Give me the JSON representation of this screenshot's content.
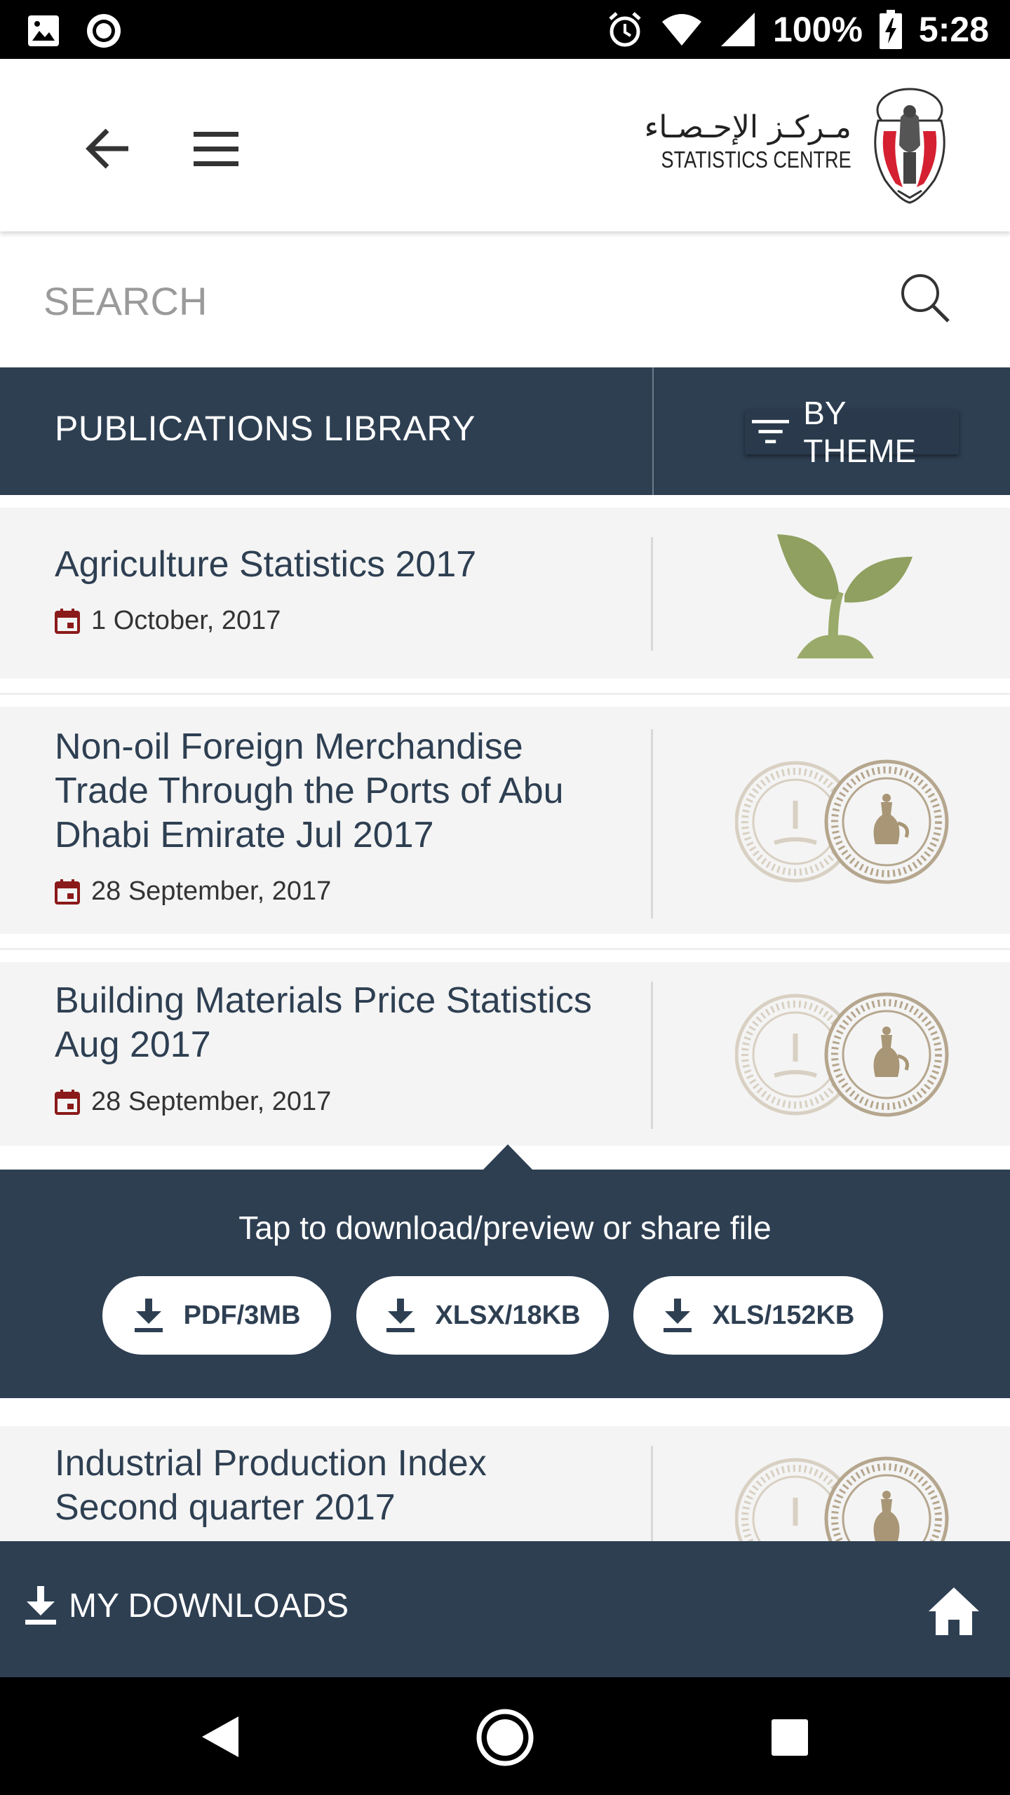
{
  "status_bar": {
    "battery": "100%",
    "time": "5:28",
    "icons": [
      "image-icon",
      "record-icon",
      "alarm-icon",
      "wifi-icon",
      "signal-icon",
      "battery-charging-icon"
    ]
  },
  "header": {
    "logo_arabic": "مـركـز الإحـصـاء",
    "logo_english": "STATISTICS CENTRE",
    "back_icon": "arrow-left-icon",
    "menu_icon": "hamburger-icon"
  },
  "search": {
    "placeholder": "SEARCH",
    "value": ""
  },
  "library": {
    "title": "PUBLICATIONS LIBRARY",
    "filter_label": "BY THEME"
  },
  "publications": [
    {
      "title": "Agriculture Statistics 2017",
      "date": "1 October, 2017",
      "icon": "plant-icon"
    },
    {
      "title": "Non-oil Foreign Merchandise Trade Through the Ports of Abu Dhabi Emirate Jul 2017",
      "date": "28 September, 2017",
      "icon": "coins-icon"
    },
    {
      "title": "Building Materials Price Statistics Aug 2017",
      "date": "28 September, 2017",
      "icon": "coins-icon"
    },
    {
      "title": "Industrial Production Index Second quarter 2017",
      "date": "",
      "icon": "coins-icon"
    }
  ],
  "download_panel": {
    "hint": "Tap to download/preview or share file",
    "files": [
      {
        "label": "PDF/3MB"
      },
      {
        "label": "XLSX/18KB"
      },
      {
        "label": "XLS/152KB"
      }
    ]
  },
  "bottom_bar": {
    "downloads_label": "MY DOWNLOADS",
    "home_icon": "home-icon"
  },
  "colors": {
    "primary": "#2e3f52",
    "date_icon": "#8b1a1a",
    "plant": "#9aaa6a",
    "coin": "#b5a68e"
  }
}
